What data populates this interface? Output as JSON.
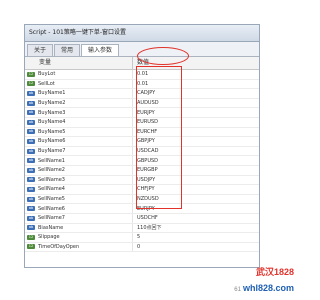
{
  "window": {
    "title": "Script - 101策略一键下单-窗口设置",
    "tabs": [
      {
        "label": "关于",
        "active": false
      },
      {
        "label": "常用",
        "active": false
      },
      {
        "label": "输入参数",
        "active": true
      }
    ]
  },
  "grid": {
    "columns": {
      "variable": "变量",
      "value": "数值"
    },
    "rows": [
      {
        "type": "val",
        "name": "BuyLot",
        "value": "0.01"
      },
      {
        "type": "val",
        "name": "SellLot",
        "value": "0.01"
      },
      {
        "type": "ab",
        "name": "BuyName1",
        "value": "CADJPY"
      },
      {
        "type": "ab",
        "name": "BuyName2",
        "value": "AUDUSD"
      },
      {
        "type": "ab",
        "name": "BuyName3",
        "value": "EURJPY"
      },
      {
        "type": "ab",
        "name": "BuyName4",
        "value": "EURUSD"
      },
      {
        "type": "ab",
        "name": "BuyName5",
        "value": "EURCHF"
      },
      {
        "type": "ab",
        "name": "BuyName6",
        "value": "GBPJPY"
      },
      {
        "type": "ab",
        "name": "BuyName7",
        "value": "USDCAD"
      },
      {
        "type": "ab",
        "name": "SellName1",
        "value": "GBPUSD"
      },
      {
        "type": "ab",
        "name": "SellName2",
        "value": "EURGBP"
      },
      {
        "type": "ab",
        "name": "SellName3",
        "value": "USDJPY"
      },
      {
        "type": "ab",
        "name": "SellName4",
        "value": "CHFJPY"
      },
      {
        "type": "ab",
        "name": "SellName5",
        "value": "NZDUSD"
      },
      {
        "type": "ab",
        "name": "SellName6",
        "value": "EURJPY"
      },
      {
        "type": "ab",
        "name": "SellName7",
        "value": "USDCHF"
      },
      {
        "type": "ab",
        "name": "BiasName",
        "value": "110点回下"
      },
      {
        "type": "val",
        "name": "Slippage",
        "value": "5"
      },
      {
        "type": "val",
        "name": "TimeOfDayOpen",
        "value": "0"
      }
    ]
  },
  "watermark": {
    "line1": "武汉1828",
    "prefix": "61",
    "line2": "whl828.com"
  },
  "colors": {
    "highlight": "#e2322b",
    "tab_active": "#ffffff"
  }
}
